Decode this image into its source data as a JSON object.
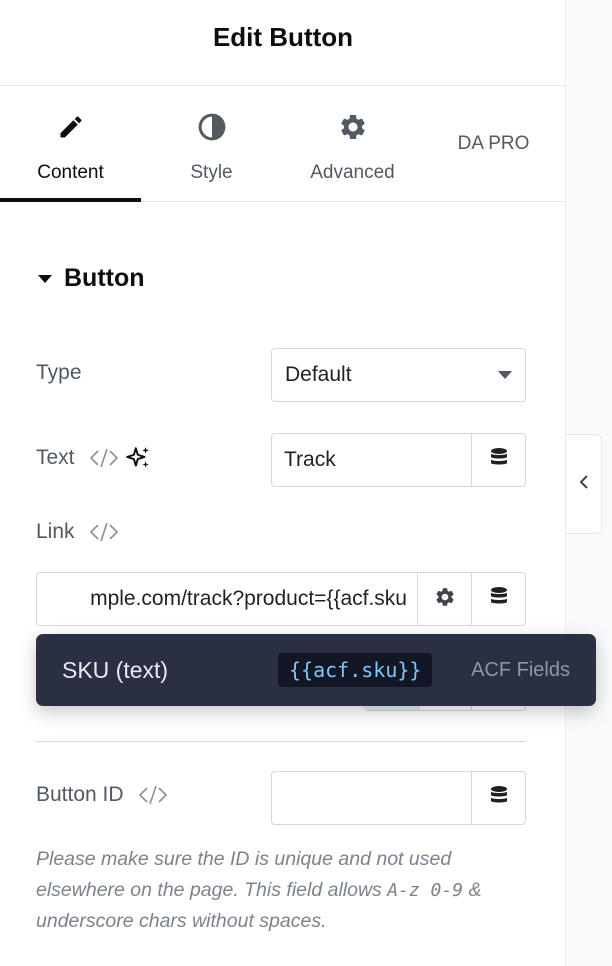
{
  "header": {
    "title": "Edit Button"
  },
  "tabs": [
    {
      "label": "Content",
      "icon": "pencil-icon",
      "active": true
    },
    {
      "label": "Style",
      "icon": "half-circle-icon",
      "active": false
    },
    {
      "label": "Advanced",
      "icon": "gear-icon",
      "active": false
    },
    {
      "label": "DA PRO",
      "icon": "",
      "active": false
    }
  ],
  "section": {
    "title": "Button",
    "expanded": true
  },
  "type_control": {
    "label": "Type",
    "value": "Default"
  },
  "text_control": {
    "label": "Text",
    "value": "Track"
  },
  "link_control": {
    "label": "Link",
    "value": "mple.com/track?product={{acf.sku"
  },
  "popup": {
    "name": "SKU (text)",
    "token": "{{acf.sku}}",
    "source": "ACF Fields"
  },
  "button_id_control": {
    "label": "Button ID",
    "value": ""
  },
  "help": {
    "part1": "Please make sure the ID is unique and not used elsewhere on the page. This field allows ",
    "code1": "A-z 0-9",
    "part2": " & underscore chars without spaces."
  },
  "colors": {
    "popup_bg": "#2a3042",
    "token_bg": "#131725",
    "token_text": "#7cc7ff",
    "text_primary": "#0c0d0e",
    "text_secondary": "#515962"
  }
}
